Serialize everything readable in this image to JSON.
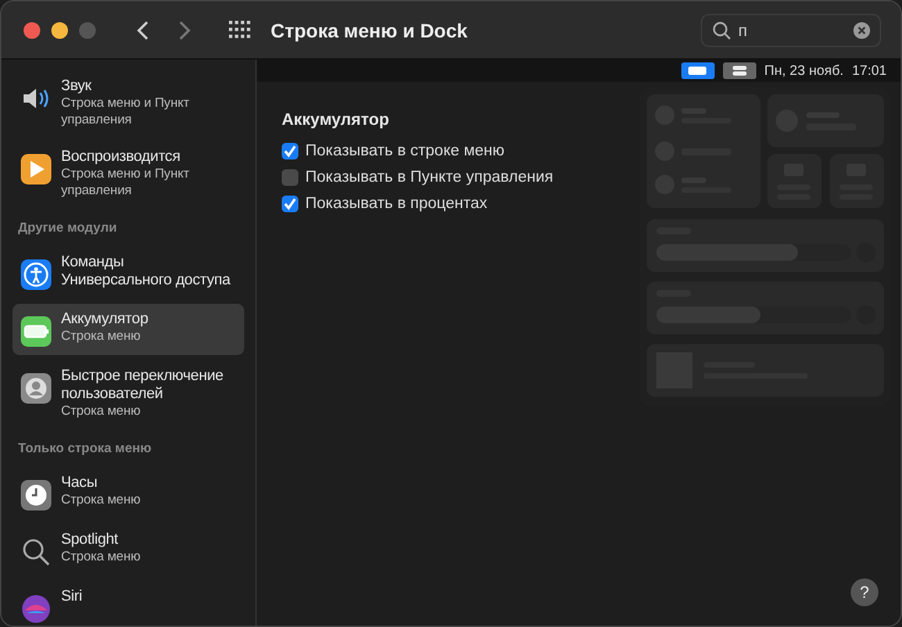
{
  "window": {
    "title": "Строка меню и Dock"
  },
  "search": {
    "value": "п"
  },
  "menu_bar": {
    "date": "Пн, 23 нояб.",
    "time": "17:01"
  },
  "sidebar": {
    "items": [
      {
        "kind": "item",
        "title": "Звук",
        "subtitle": "Строка меню и Пункт управления",
        "selected": false
      },
      {
        "kind": "item",
        "title": "Воспроизводится",
        "subtitle": "Строка меню и Пункт управления",
        "selected": false
      },
      {
        "kind": "header",
        "title": "Другие модули"
      },
      {
        "kind": "item",
        "title": "Команды Универсального доступа",
        "selected": false
      },
      {
        "kind": "item",
        "title": "Аккумулятор",
        "subtitle": "Строка меню",
        "selected": true
      },
      {
        "kind": "item",
        "title": "Быстрое переключение пользователей",
        "subtitle": "Строка меню",
        "selected": false
      },
      {
        "kind": "header",
        "title": "Только строка меню"
      },
      {
        "kind": "item",
        "title": "Часы",
        "subtitle": "Строка меню",
        "selected": false
      },
      {
        "kind": "item",
        "title": "Spotlight",
        "subtitle": "Строка меню",
        "selected": false
      },
      {
        "kind": "item",
        "title": "Siri",
        "selected": false
      }
    ]
  },
  "content": {
    "heading": "Аккумулятор",
    "options": [
      {
        "label": "Показывать в строке меню",
        "checked": true
      },
      {
        "label": "Показывать в Пункте управления",
        "checked": false
      },
      {
        "label": "Показывать в процентах",
        "checked": true
      }
    ]
  },
  "help": "?"
}
